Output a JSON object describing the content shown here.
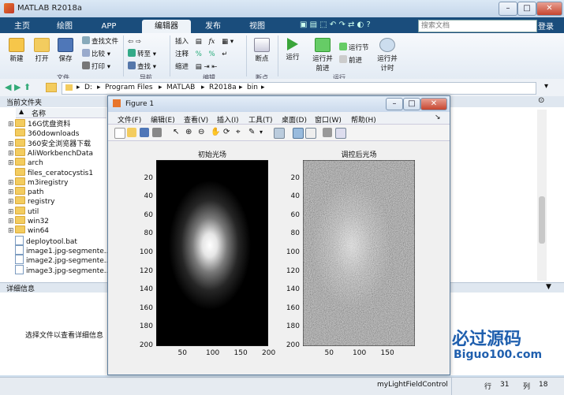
{
  "window": {
    "title": "MATLAB R2018a"
  },
  "ribbon_tabs": [
    "主页",
    "绘图",
    "APP",
    "编辑器",
    "发布",
    "视图"
  ],
  "search": {
    "placeholder": "搜索文档"
  },
  "login": "登录",
  "ribbon": {
    "file": {
      "new": "新建",
      "open": "打开",
      "save": "保存",
      "find_files": "查找文件",
      "compare": "比较",
      "print": "打印",
      "group": "文件"
    },
    "nav": {
      "goto": "转至",
      "find": "查找",
      "group": "导航"
    },
    "edit": {
      "insert": "插入",
      "comment": "注释",
      "indent": "缩进",
      "group": "编辑"
    },
    "breakpoints": {
      "label": "断点",
      "group": "断点"
    },
    "run": {
      "run": "运行",
      "run_advance": "运行并前进",
      "run_section": "运行节",
      "advance": "前进",
      "run_time": "运行并计时",
      "group": "运行"
    }
  },
  "address": {
    "crumbs": [
      "D:",
      "Program Files",
      "MATLAB",
      "R2018a",
      "bin"
    ]
  },
  "folder": {
    "header": "当前文件夹",
    "name_col": "名称",
    "items": [
      {
        "name": "16G优盘资料",
        "kind": "folder",
        "expand": "⊞"
      },
      {
        "name": "360downloads",
        "kind": "folder",
        "expand": ""
      },
      {
        "name": "360安全浏览器下载",
        "kind": "folder",
        "expand": "⊞"
      },
      {
        "name": "AliWorkbenchData",
        "kind": "folder",
        "expand": "⊞"
      },
      {
        "name": "arch",
        "kind": "folder",
        "expand": "⊞"
      },
      {
        "name": "files_ceratocystis1",
        "kind": "folder",
        "expand": ""
      },
      {
        "name": "m3iregistry",
        "kind": "folder",
        "expand": "⊞"
      },
      {
        "name": "path",
        "kind": "folder",
        "expand": "⊞"
      },
      {
        "name": "registry",
        "kind": "folder",
        "expand": "⊞"
      },
      {
        "name": "util",
        "kind": "folder",
        "expand": "⊞"
      },
      {
        "name": "win32",
        "kind": "folder",
        "expand": "⊞"
      },
      {
        "name": "win64",
        "kind": "folder",
        "expand": "⊞"
      },
      {
        "name": "deploytool.bat",
        "kind": "file",
        "expand": ""
      },
      {
        "name": "image1.jpg-segmente...",
        "kind": "file",
        "expand": ""
      },
      {
        "name": "image2.jpg-segmente...",
        "kind": "file",
        "expand": ""
      },
      {
        "name": "image3.jpg-segmente...",
        "kind": "file",
        "expand": ""
      }
    ]
  },
  "details": {
    "header": "详细信息",
    "placeholder": "选择文件以查看详细信息"
  },
  "status": {
    "function": "myLightFieldControl",
    "row_label": "行",
    "row": "31",
    "col_label": "列",
    "col": "18"
  },
  "figure": {
    "title": "Figure 1",
    "menu": [
      "文件(F)",
      "编辑(E)",
      "查看(V)",
      "插入(I)",
      "工具(T)",
      "桌面(D)",
      "窗口(W)",
      "帮助(H)"
    ],
    "left_plot": {
      "title": "初始光场",
      "yticks": [
        "20",
        "40",
        "60",
        "80",
        "100",
        "120",
        "140",
        "160",
        "180",
        "200"
      ],
      "xticks": [
        "50",
        "100",
        "150",
        "200"
      ]
    },
    "right_plot": {
      "title": "调控后光场",
      "yticks": [
        "20",
        "40",
        "60",
        "80",
        "100",
        "120",
        "140",
        "160",
        "180",
        "200"
      ],
      "xticks": [
        "50",
        "100",
        "150"
      ]
    }
  },
  "watermark": {
    "brand": "必过源码",
    "site": "Biguo100.com"
  }
}
